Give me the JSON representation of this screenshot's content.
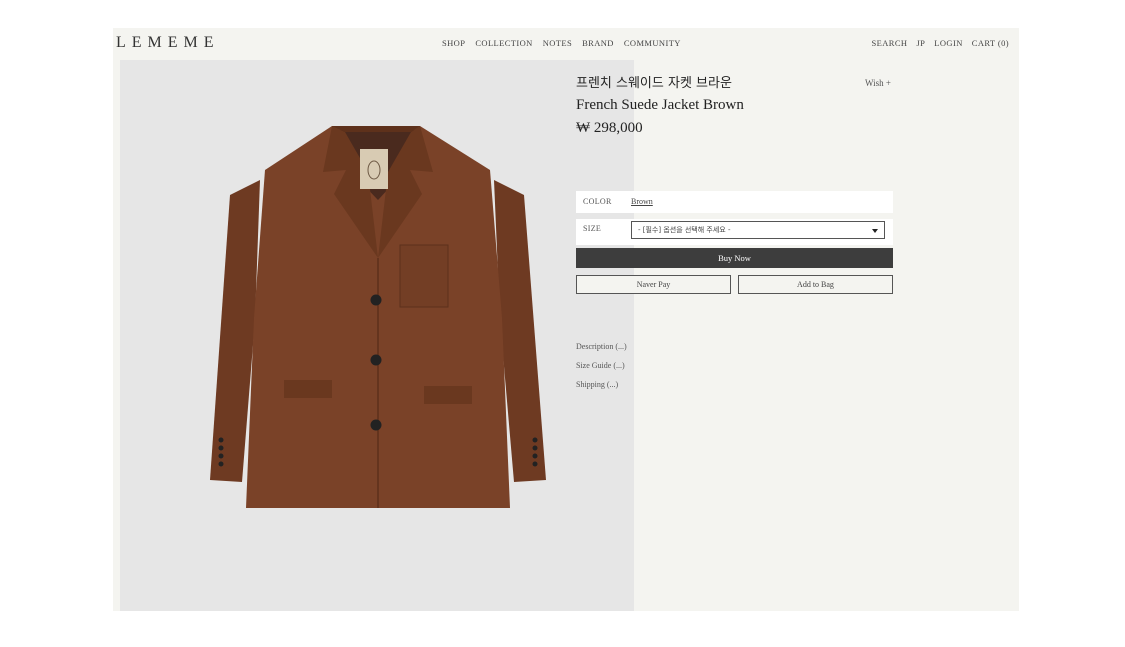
{
  "header": {
    "logo": "LEMEME",
    "nav": [
      "SHOP",
      "COLLECTION",
      "NOTES",
      "BRAND",
      "COMMUNITY"
    ],
    "utility": [
      "SEARCH",
      "JP",
      "LOGIN",
      "CART (0)"
    ]
  },
  "product": {
    "name_kr": "프렌치 스웨이드 자켓 브라운",
    "name_en": "French Suede Jacket Brown",
    "price": "₩ 298,000",
    "wish_label": "Wish +",
    "color_label": "COLOR",
    "color_value": "Brown",
    "size_label": "SIZE",
    "size_placeholder": "- [필수] 옵션을 선택해 주세요 -",
    "buy_now": "Buy Now",
    "naver_pay": "Naver Pay",
    "add_to_bag": "Add to Bag",
    "info_links": [
      "Description (...)",
      "Size Guide (...)",
      "Shipping (...)"
    ]
  },
  "colors": {
    "page_bg": "#f4f4f0",
    "photo_bg": "#e6e6e6",
    "jacket": "#7a4228",
    "buy_button": "#3d3d3d"
  },
  "icons": [
    "chevron-down-icon"
  ]
}
